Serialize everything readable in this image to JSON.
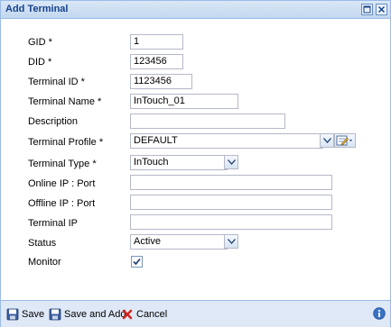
{
  "window": {
    "title": "Add Terminal"
  },
  "form": {
    "gid": {
      "label": "GID *",
      "value": "1"
    },
    "did": {
      "label": "DID *",
      "value": "123456"
    },
    "terminal_id": {
      "label": "Terminal ID *",
      "value": "1123456"
    },
    "terminal_name": {
      "label": "Terminal Name *",
      "value": "InTouch_01"
    },
    "description": {
      "label": "Description",
      "value": ""
    },
    "terminal_profile": {
      "label": "Terminal Profile *",
      "value": "DEFAULT"
    },
    "terminal_type": {
      "label": "Terminal Type *",
      "value": "InTouch"
    },
    "online_ip": {
      "label": "Online IP : Port",
      "value": ""
    },
    "offline_ip": {
      "label": "Offline IP : Port",
      "value": ""
    },
    "terminal_ip": {
      "label": "Terminal IP",
      "value": ""
    },
    "status": {
      "label": "Status",
      "value": "Active"
    },
    "monitor": {
      "label": "Monitor",
      "checked": true
    }
  },
  "footer": {
    "save_label": "Save",
    "save_add_label": "Save and Add",
    "cancel_label": "Cancel"
  },
  "colors": {
    "title_text": "#15428b",
    "panel_border": "#99bbe8",
    "footer_bg": "#dfe8f6"
  }
}
